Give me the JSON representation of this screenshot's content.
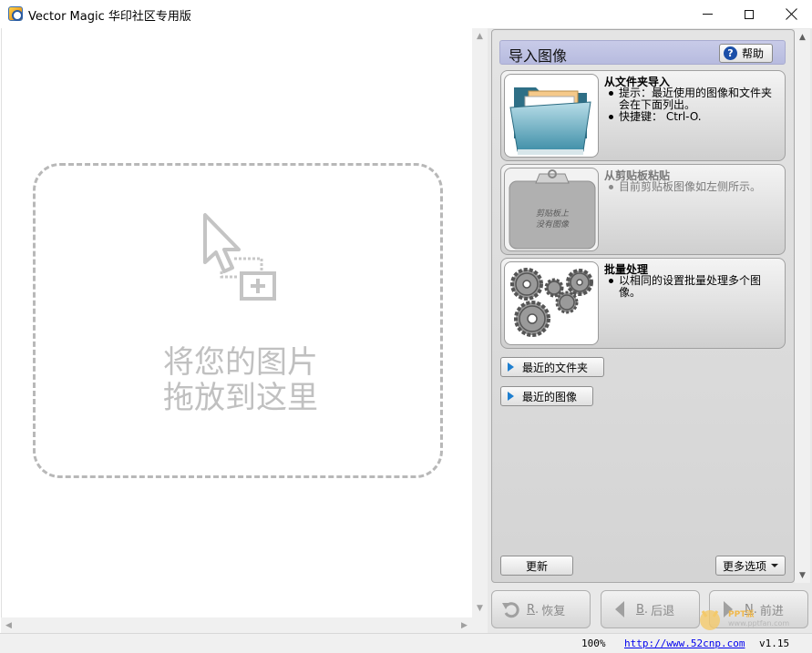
{
  "window": {
    "title": "Vector Magic 华印社区专用版"
  },
  "dropzone": {
    "line1": "将您的图片",
    "line2": "拖放到这里"
  },
  "panel": {
    "header": "导入图像",
    "help_label": "帮助",
    "cards": [
      {
        "title": "从文件夹导入",
        "bullets": [
          "提示：最近使用的图像和文件夹会在下面列出。",
          "快捷键： Ctrl-O."
        ],
        "enabled": true
      },
      {
        "title": "从剪贴板粘贴",
        "bullets": [
          "目前剪贴板图像如左侧所示。"
        ],
        "enabled": false,
        "thumb_text": [
          "剪贴板上",
          "没有图像"
        ]
      },
      {
        "title": "批量处理",
        "bullets": [
          "以相同的设置批量处理多个图像。"
        ],
        "enabled": true
      }
    ],
    "recent_folders": "最近的文件夹",
    "recent_images": "最近的图像",
    "update": "更新",
    "more_options": "更多选项"
  },
  "nav": {
    "restore": {
      "key": "R",
      "label": "恢复"
    },
    "back": {
      "key": "B",
      "label": "后退"
    },
    "next": {
      "key": "N",
      "label": "前进"
    }
  },
  "status": {
    "zoom": "100%",
    "url": "http://www.52cnp.com",
    "version": "v1.15"
  },
  "watermark": {
    "text": "PPT派",
    "url": "www.pptfan.com"
  },
  "colors": {
    "header_bg": "#b7bbdf",
    "help_icon": "#1b4fa8",
    "expander_arrow": "#1e7fd0",
    "link": "#0000ee"
  }
}
